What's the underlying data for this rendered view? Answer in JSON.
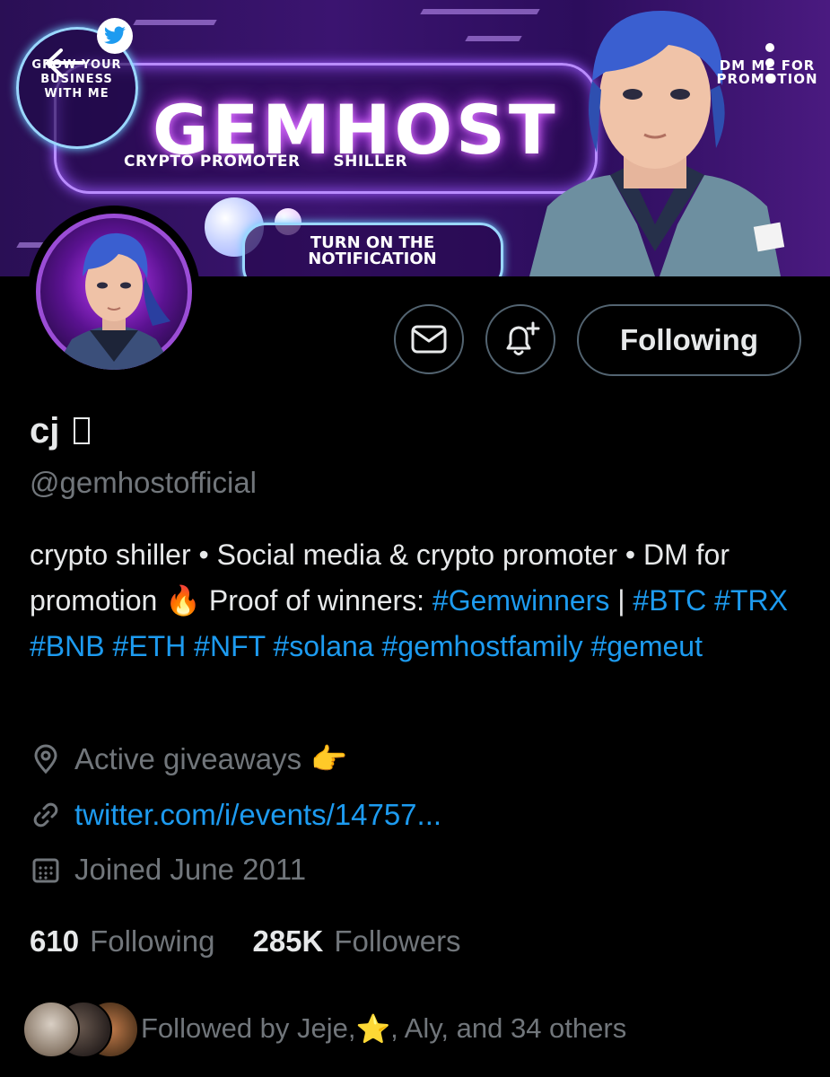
{
  "banner": {
    "brand": "GEMHOST",
    "subtitle_left": "CRYPTO PROMOTER",
    "subtitle_right": "SHILLER",
    "grow_badge": "GROW YOUR BUSINESS WITH ME",
    "dm_badge": "DM ME FOR PROMOTION",
    "notify": "TURN ON THE NOTIFICATION",
    "back_icon": "arrow-left-icon",
    "more_icon": "more-vertical-icon"
  },
  "actions": {
    "message_icon": "envelope-icon",
    "notify_icon": "bell-plus-icon",
    "following_label": "Following"
  },
  "profile": {
    "name": "cj",
    "handle": "@gemhostofficial",
    "bio_text_1": "crypto shiller • Social media & crypto promoter • DM for promotion ",
    "bio_emoji_fire": "🔥",
    "bio_text_2": " Proof of winners: ",
    "bio_tag_1": "#Gemwinners",
    "bio_sep": " | ",
    "bio_tags": "#BTC #TRX #BNB #ETH #NFT #solana #gemhostfamily #gemeut",
    "location": "Active giveaways",
    "location_emoji": "👉",
    "url": "twitter.com/i/events/14757...",
    "joined": "Joined June 2011"
  },
  "stats": {
    "following_count": "610",
    "following_label": "Following",
    "followers_count": "285K",
    "followers_label": "Followers"
  },
  "followed_by": {
    "prefix": "Followed by Jeje, ",
    "star": "⭐",
    "suffix": ", Aly, and 34 others"
  },
  "colors": {
    "background": "#000000",
    "text_primary": "#e7e9ea",
    "text_secondary": "#71767b",
    "link": "#1d9bf0",
    "border": "#536471"
  }
}
